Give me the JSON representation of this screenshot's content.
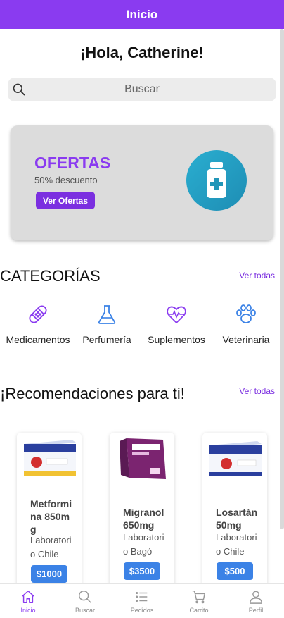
{
  "header": {
    "title": "Inicio"
  },
  "greeting": "¡Hola, Catherine!",
  "search": {
    "placeholder": "Buscar"
  },
  "banner": {
    "title": "OFERTAS",
    "subtitle": "50% descuento",
    "button_label": "Ver Ofertas",
    "icon": "medicine-bottle-icon"
  },
  "categories": {
    "title": "CATEGORÍAS",
    "see_all": "Ver todas",
    "items": [
      {
        "label": "Medicamentos",
        "icon": "bandage-icon"
      },
      {
        "label": "Perfumería",
        "icon": "flask-icon"
      },
      {
        "label": "Suplementos",
        "icon": "heartbeat-icon"
      },
      {
        "label": "Veterinaria",
        "icon": "paw-icon"
      }
    ]
  },
  "recommendations": {
    "title": "¡Recomendaciones para ti!",
    "see_all": "Ver todas",
    "products": [
      {
        "name": "Metformina 850mg",
        "lab": "Laboratorio Chile",
        "price": "$1000"
      },
      {
        "name": "Migranol 650mg",
        "lab": "Laboratorio Bagó",
        "price": "$3500"
      },
      {
        "name": "Losartán 50mg",
        "lab": "Laboratorio Chile",
        "price": "$500"
      }
    ]
  },
  "tabs": [
    {
      "label": "Inicio",
      "icon": "home-icon",
      "active": true
    },
    {
      "label": "Buscar",
      "icon": "search-icon",
      "active": false
    },
    {
      "label": "Pedidos",
      "icon": "list-icon",
      "active": false
    },
    {
      "label": "Carrito",
      "icon": "cart-icon",
      "active": false
    },
    {
      "label": "Perfil",
      "icon": "user-icon",
      "active": false
    }
  ],
  "colors": {
    "accent": "#8a3bf0",
    "price": "#3b82e6",
    "banner_icon": "#2aaed0"
  }
}
